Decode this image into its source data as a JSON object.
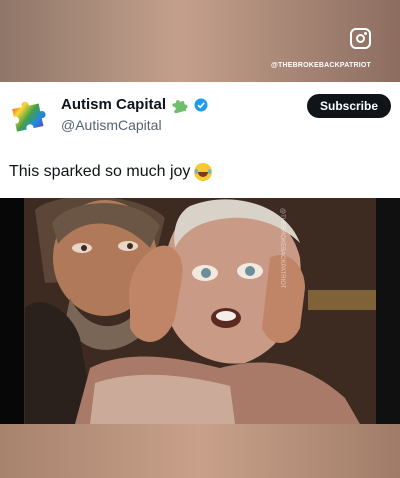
{
  "overlay": {
    "instagram_icon": "instagram-icon",
    "watermark": "@THEBROKEBACKPATRIOT"
  },
  "tweet": {
    "author_name": "Autism Capital",
    "handle": "@AutismCapital",
    "subscribe_label": "Subscribe",
    "text": "This sparked so much joy",
    "emoji": "tears-of-joy-emoji",
    "verified_color": "#1d9bf0"
  },
  "media": {
    "watermark": "@THEBROKEBACKPATRIOT"
  }
}
